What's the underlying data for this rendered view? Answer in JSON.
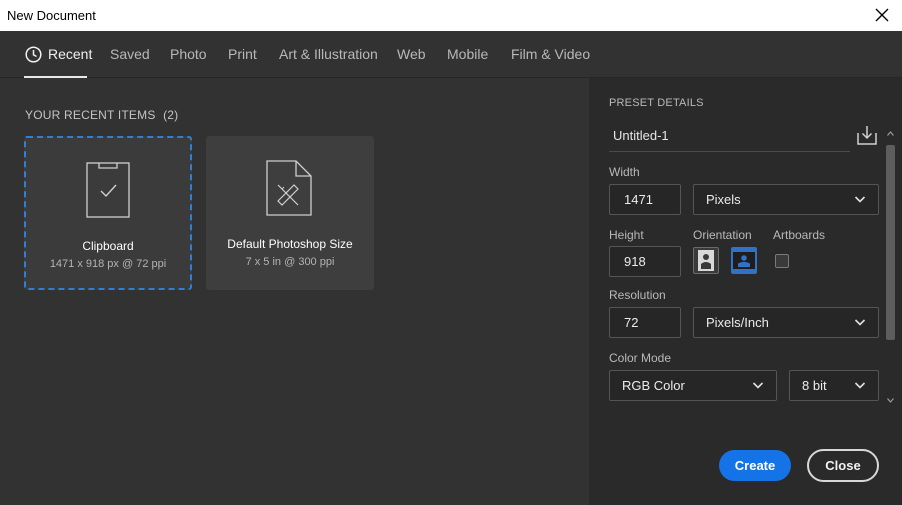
{
  "window": {
    "title": "New Document"
  },
  "tabs": [
    {
      "label": "Recent",
      "active": true
    },
    {
      "label": "Saved"
    },
    {
      "label": "Photo"
    },
    {
      "label": "Print"
    },
    {
      "label": "Art & Illustration"
    },
    {
      "label": "Web"
    },
    {
      "label": "Mobile"
    },
    {
      "label": "Film & Video"
    }
  ],
  "recent": {
    "header": "YOUR RECENT ITEMS",
    "count": "(2)",
    "items": [
      {
        "name": "Clipboard",
        "size": "1471 x 918 px @ 72 ppi",
        "icon": "clipboard-icon",
        "selected": true
      },
      {
        "name": "Default Photoshop Size",
        "size": "7 x 5 in @ 300 ppi",
        "icon": "document-ruler-icon"
      }
    ]
  },
  "preset": {
    "label": "PRESET DETAILS",
    "name": "Untitled-1",
    "width_label": "Width",
    "width_value": "1471",
    "width_unit": "Pixels",
    "height_label": "Height",
    "height_value": "918",
    "orientation_label": "Orientation",
    "artboards_label": "Artboards",
    "resolution_label": "Resolution",
    "resolution_value": "72",
    "resolution_unit": "Pixels/Inch",
    "color_mode_label": "Color Mode",
    "color_mode": "RGB Color",
    "bit_depth": "8 bit"
  },
  "buttons": {
    "create": "Create",
    "close": "Close"
  },
  "colors": {
    "accent": "#1473e6",
    "selection": "#2f7fd6",
    "panel": "#323232",
    "sidebar": "#2a2a2a"
  }
}
